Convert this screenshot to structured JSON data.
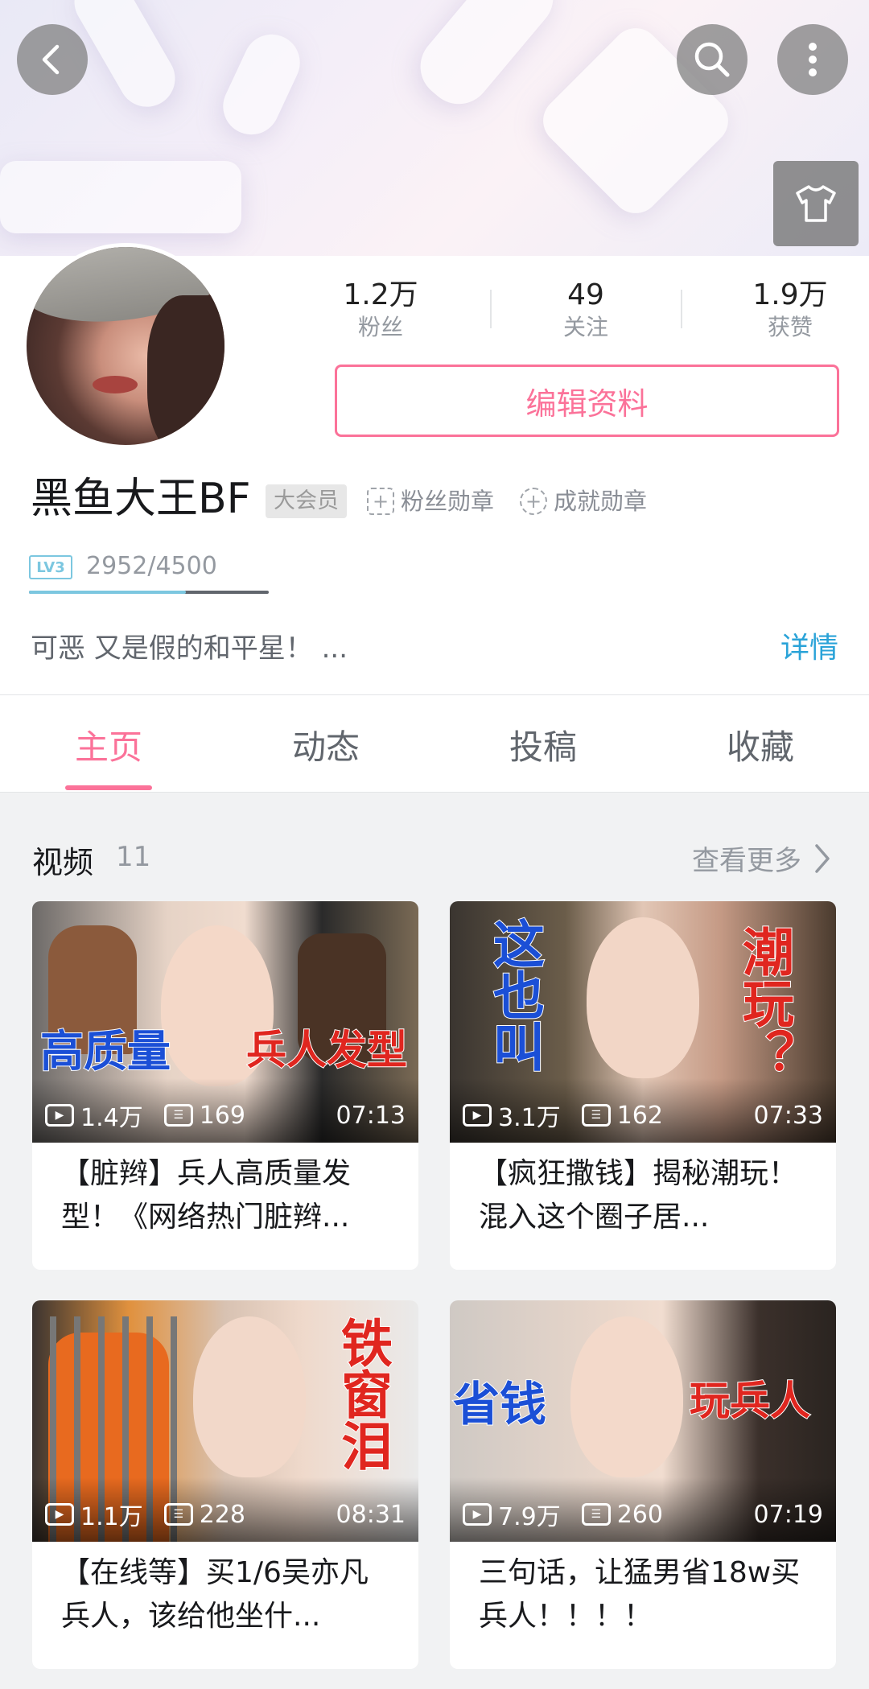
{
  "colors": {
    "accent": "#fb7299",
    "link": "#2aa3d8"
  },
  "topbar": {
    "back_icon": "chevron-left-icon",
    "search_icon": "search-icon",
    "more_icon": "more-vertical-icon",
    "skin_icon": "tshirt-icon"
  },
  "profile": {
    "stats": [
      {
        "value": "1.2万",
        "label": "粉丝"
      },
      {
        "value": "49",
        "label": "关注"
      },
      {
        "value": "1.9万",
        "label": "获赞"
      }
    ],
    "edit_label": "编辑资料",
    "username": "黑鱼大王BF",
    "vip_badge": "大会员",
    "fan_medal": "粉丝勋章",
    "achievement_medal": "成就勋章",
    "level": "LV3",
    "exp_text": "2952/4500",
    "exp_progress": 0.656,
    "signature": "可恶 又是假的和平星！ ...",
    "detail_link": "详情"
  },
  "tabs": [
    {
      "label": "主页",
      "active": true
    },
    {
      "label": "动态",
      "active": false
    },
    {
      "label": "投稿",
      "active": false
    },
    {
      "label": "收藏",
      "active": false
    }
  ],
  "videos_section": {
    "title": "视频",
    "count": "11",
    "more_label": "查看更多"
  },
  "videos": [
    {
      "plays": "1.4万",
      "danmaku": "169",
      "duration": "07:13",
      "title": "【脏辫】兵人高质量发型！《网络热门脏辫...",
      "captions": [
        "高质量",
        "兵人发型"
      ]
    },
    {
      "plays": "3.1万",
      "danmaku": "162",
      "duration": "07:33",
      "title": "【疯狂撒钱】揭秘潮玩！混入这个圈子居...",
      "captions": [
        "这也叫",
        "潮玩？"
      ]
    },
    {
      "plays": "1.1万",
      "danmaku": "228",
      "duration": "08:31",
      "title": "【在线等】买1/6吴亦凡兵人，该给他坐什...",
      "captions": [
        "铁窗泪"
      ]
    },
    {
      "plays": "7.9万",
      "danmaku": "260",
      "duration": "07:19",
      "title": "三句话，让猛男省18w买兵人！！！！",
      "captions": [
        "省钱",
        "玩兵人"
      ]
    }
  ]
}
